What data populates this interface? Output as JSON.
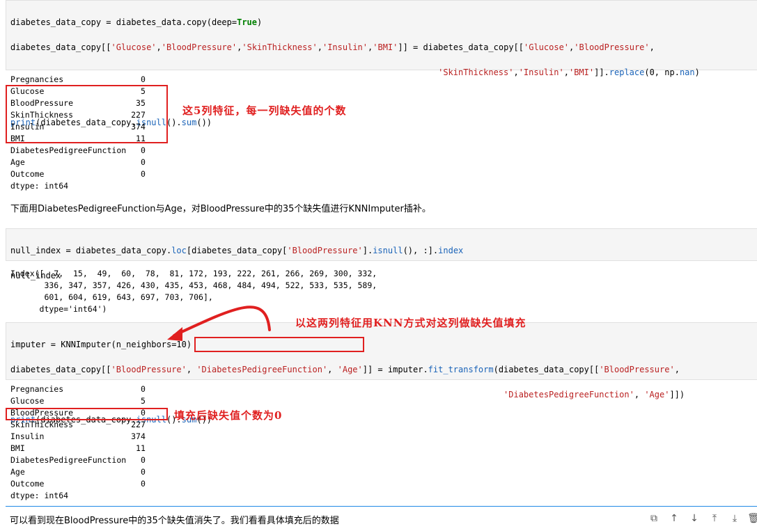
{
  "cells": {
    "c1": {
      "lines": [
        "diabetes_data_copy = diabetes_data.copy(deep=True)",
        "diabetes_data_copy[['Glucose','BloodPressure','SkinThickness','Insulin','BMI']] = diabetes_data_copy[['Glucose','BloodPressure',",
        "                                                                                     'SkinThickness','Insulin','BMI']].replace(0, np.nan)",
        "",
        "print(diabetes_data_copy.isnull().sum())"
      ]
    },
    "o1": {
      "rows": [
        {
          "name": "Pregnancies",
          "value": "0"
        },
        {
          "name": "Glucose",
          "value": "5"
        },
        {
          "name": "BloodPressure",
          "value": "35"
        },
        {
          "name": "SkinThickness",
          "value": "227"
        },
        {
          "name": "Insulin",
          "value": "374"
        },
        {
          "name": "BMI",
          "value": "11"
        },
        {
          "name": "DiabetesPedigreeFunction",
          "value": "0"
        },
        {
          "name": "Age",
          "value": "0"
        },
        {
          "name": "Outcome",
          "value": "0"
        }
      ],
      "dtype": "dtype: int64"
    },
    "md1": "下面用DiabetesPedigreeFunction与Age，对BloodPressure中的35个缺失值进行KNNImputer插补。",
    "c2": {
      "lines": [
        "null_index = diabetes_data_copy.loc[diabetes_data_copy['BloodPressure'].isnull(), :].index",
        "null_index"
      ]
    },
    "o2": {
      "lines": [
        "Index([  7,  15,  49,  60,  78,  81, 172, 193, 222, 261, 266, 269, 300, 332,",
        "       336, 347, 357, 426, 430, 435, 453, 468, 484, 494, 522, 533, 535, 589,",
        "       601, 604, 619, 643, 697, 703, 706],",
        "      dtype='int64')"
      ]
    },
    "c3": {
      "lines": [
        "imputer = KNNImputer(n_neighbors=10)",
        "diabetes_data_copy[['BloodPressure', 'DiabetesPedigreeFunction', 'Age']] = imputer.fit_transform(diabetes_data_copy[['BloodPressure',",
        "                                                                                                  'DiabetesPedigreeFunction', 'Age']])",
        "print(diabetes_data_copy.isnull().sum())"
      ]
    },
    "o3": {
      "rows": [
        {
          "name": "Pregnancies",
          "value": "0"
        },
        {
          "name": "Glucose",
          "value": "5"
        },
        {
          "name": "BloodPressure",
          "value": "0"
        },
        {
          "name": "SkinThickness",
          "value": "227"
        },
        {
          "name": "Insulin",
          "value": "374"
        },
        {
          "name": "BMI",
          "value": "11"
        },
        {
          "name": "DiabetesPedigreeFunction",
          "value": "0"
        },
        {
          "name": "Age",
          "value": "0"
        },
        {
          "name": "Outcome",
          "value": "0"
        }
      ],
      "dtype": "dtype: int64"
    },
    "md2": "可以看到现在BloodPressure中的35个缺失值消失了。我们看看具体填充后的数据"
  },
  "annotations": {
    "a1": "这5列特征，每一列缺失值的个数",
    "a2": "以这两列特征用KNN方式对这列做缺失值填充",
    "a3": "填充后缺失值个数为0"
  },
  "toolbar": [
    {
      "name": "copy-icon",
      "glyph": "⧉"
    },
    {
      "name": "move-up-icon",
      "glyph": "↑"
    },
    {
      "name": "move-down-icon",
      "glyph": "↓"
    },
    {
      "name": "insert-above-icon",
      "glyph": "⤒"
    },
    {
      "name": "insert-below-icon",
      "glyph": "⤓"
    },
    {
      "name": "delete-icon",
      "glyph": "🗑"
    }
  ],
  "colors": {
    "annotation": "#e02020",
    "accent": "#1e88e5"
  }
}
